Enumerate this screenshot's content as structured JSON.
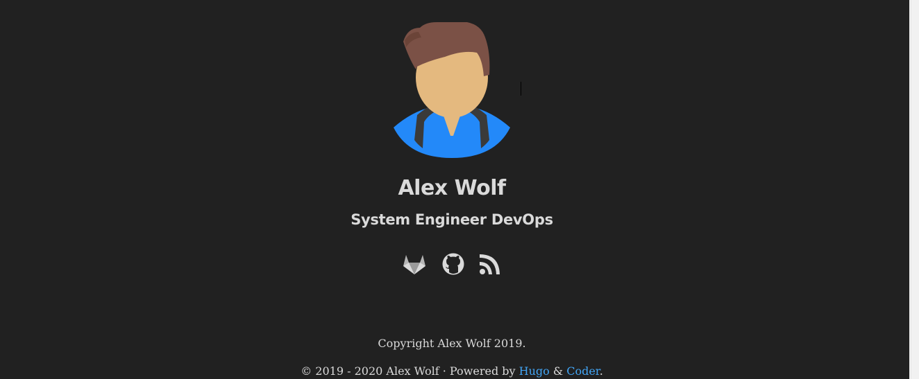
{
  "profile": {
    "name": "Alex Wolf",
    "role": "System Engineer DevOps"
  },
  "social": [
    {
      "name": "GitLab",
      "icon": "gitlab-icon"
    },
    {
      "name": "GitHub",
      "icon": "github-icon"
    },
    {
      "name": "RSS",
      "icon": "rss-icon"
    }
  ],
  "footer": {
    "copyright": "Copyright Alex Wolf 2019.",
    "years": "© 2019 - 2020 Alex Wolf · Powered by ",
    "hugo_link": "Hugo",
    "and": " & ",
    "coder_link": "Coder",
    "end": "."
  },
  "colors": {
    "background": "#212121",
    "text": "#dadada",
    "link": "#42a5f5",
    "hair": "#7b5146",
    "skin": "#e4b97f",
    "shirt": "#2389f9"
  }
}
